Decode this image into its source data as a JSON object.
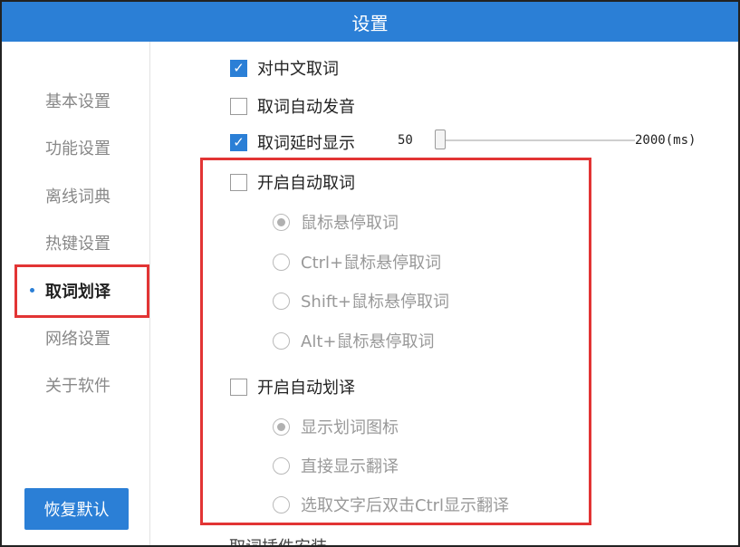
{
  "window": {
    "title": "设置"
  },
  "sidebar": {
    "items": [
      {
        "label": "基本设置",
        "active": false
      },
      {
        "label": "功能设置",
        "active": false
      },
      {
        "label": "离线词典",
        "active": false
      },
      {
        "label": "热键设置",
        "active": false
      },
      {
        "label": "取词划译",
        "active": true
      },
      {
        "label": "网络设置",
        "active": false
      },
      {
        "label": "关于软件",
        "active": false
      }
    ],
    "restore_button": "恢复默认"
  },
  "options": {
    "chinese_lookup": {
      "label": "对中文取词",
      "checked": true
    },
    "auto_pronounce": {
      "label": "取词自动发音",
      "checked": false
    },
    "delay_display": {
      "label": "取词延时显示",
      "checked": true,
      "slider_min_label": "50",
      "slider_max_label": "2000(ms)",
      "slider_value": 50
    },
    "auto_lookup": {
      "label": "开启自动取词",
      "checked": false,
      "modes": [
        {
          "label": "鼠标悬停取词",
          "selected": true
        },
        {
          "label": "Ctrl+鼠标悬停取词",
          "selected": false
        },
        {
          "label": "Shift+鼠标悬停取词",
          "selected": false
        },
        {
          "label": "Alt+鼠标悬停取词",
          "selected": false
        }
      ]
    },
    "auto_translate": {
      "label": "开启自动划译",
      "checked": false,
      "modes": [
        {
          "label": "显示划词图标",
          "selected": true
        },
        {
          "label": "直接显示翻译",
          "selected": false
        },
        {
          "label": "选取文字后双击Ctrl显示翻译",
          "selected": false
        }
      ]
    },
    "next_section_partial": "取词插件安装"
  },
  "colors": {
    "accent": "#2b7fd6",
    "highlight": "#e23434"
  },
  "icons": {
    "check": "check-icon",
    "radio": "radio-dot-icon"
  }
}
